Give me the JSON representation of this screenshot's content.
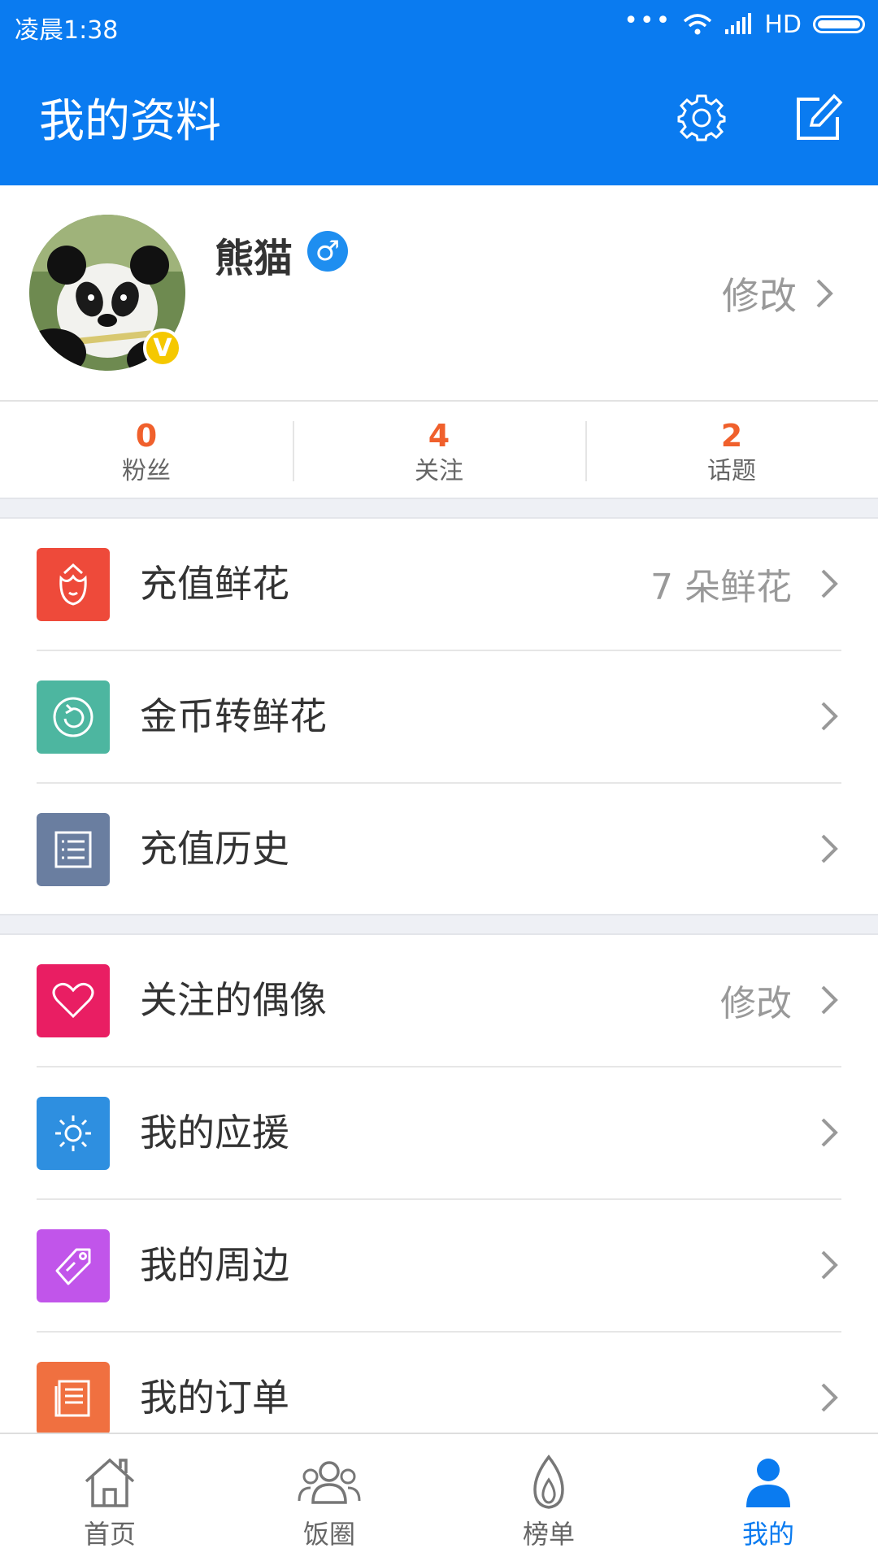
{
  "status_bar": {
    "time": "凌晨1:38",
    "dots": "•••",
    "network": "HD"
  },
  "header": {
    "title": "我的资料"
  },
  "profile": {
    "name": "熊猫",
    "badge": "V",
    "gender_symbol": "♂",
    "edit_label": "修改"
  },
  "stats": [
    {
      "value": "0",
      "label": "粉丝"
    },
    {
      "value": "4",
      "label": "关注"
    },
    {
      "value": "2",
      "label": "话题"
    }
  ],
  "menu": [
    {
      "label": "充值鲜花",
      "right_text": "7 朵鲜花",
      "icon": "flower-icon",
      "color": "#ee4a3a"
    },
    {
      "label": "金币转鲜花",
      "right_text": "",
      "icon": "exchange-icon",
      "color": "#4db6a0"
    },
    {
      "label": "充值历史",
      "right_text": "",
      "icon": "list-icon",
      "color": "#6a7ea0"
    },
    {
      "label": "关注的偶像",
      "right_text": "修改",
      "icon": "heart-icon",
      "color": "#e91e63"
    },
    {
      "label": "我的应援",
      "right_text": "",
      "icon": "sun-icon",
      "color": "#2e8fe0"
    },
    {
      "label": "我的周边",
      "right_text": "",
      "icon": "tag-icon",
      "color": "#c155ea"
    },
    {
      "label": "我的订单",
      "right_text": "",
      "icon": "receipt-icon",
      "color": "#f07040"
    }
  ],
  "tabs": [
    {
      "label": "首页",
      "icon": "home-icon"
    },
    {
      "label": "饭圈",
      "icon": "group-icon"
    },
    {
      "label": "榜单",
      "icon": "flame-icon"
    },
    {
      "label": "我的",
      "icon": "person-icon",
      "active": true
    }
  ],
  "colors": {
    "primary": "#0a7bf0",
    "accent": "#f0602c"
  }
}
